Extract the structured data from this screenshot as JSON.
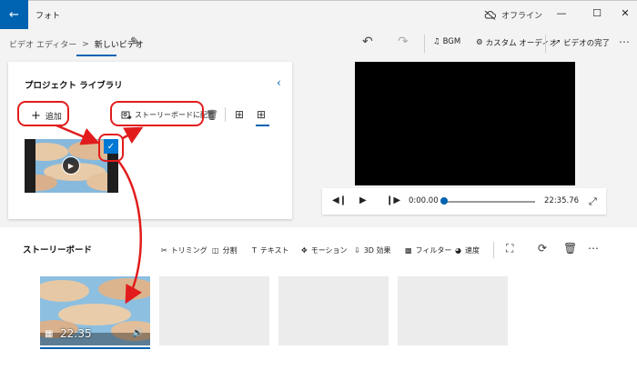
{
  "titlebar": {
    "app_title": "フォト",
    "offline_label": "オフライン"
  },
  "toolbar": {
    "breadcrumb_parent": "ビデオ エディター",
    "breadcrumb_separator": ">",
    "project_name": "新しいビデオ",
    "bgm_label": "BGM",
    "custom_audio_label": "カスタム オーディオ",
    "finish_video_label": "ビデオの完了"
  },
  "library": {
    "title": "プロジェクト ライブラリ",
    "add_label": "追加",
    "place_on_storyboard_label": "ストーリーボードに配置"
  },
  "player": {
    "current_time": "0:00.00",
    "total_time": "22:35.76",
    "progress": 0.0
  },
  "storyboard": {
    "title": "ストーリーボード",
    "tools": [
      {
        "label": "トリミング",
        "icon": "trim-icon"
      },
      {
        "label": "分割",
        "icon": "split-icon"
      },
      {
        "label": "テキスト",
        "icon": "text-icon"
      },
      {
        "label": "モーション",
        "icon": "motion-icon"
      },
      {
        "label": "3D 効果",
        "icon": "3d-effects-icon"
      },
      {
        "label": "フィルター",
        "icon": "filter-icon"
      },
      {
        "label": "速度",
        "icon": "speed-icon"
      }
    ],
    "clip_duration": "22:35"
  },
  "colors": {
    "accent": "#0063b1",
    "annotation_red": "#e21c1c",
    "check_blue": "#0078d4"
  }
}
